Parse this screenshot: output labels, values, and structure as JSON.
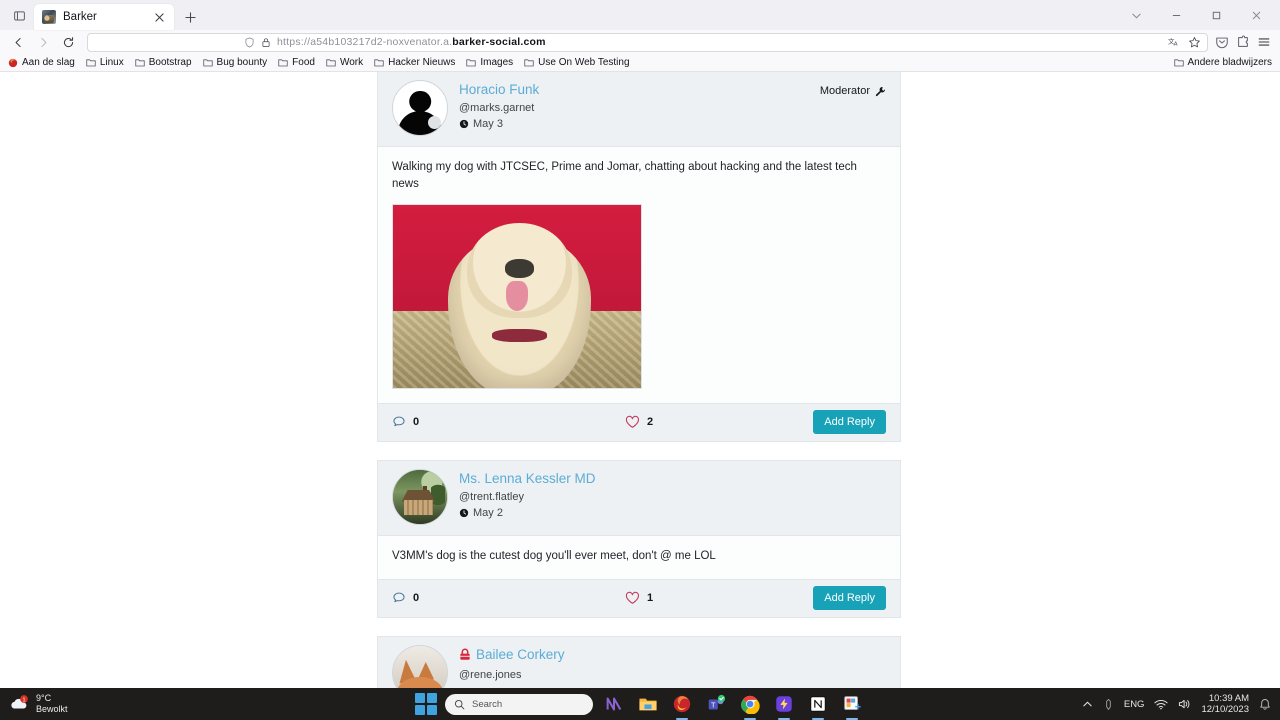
{
  "browser": {
    "tab": {
      "title": "Barker",
      "favicon_icon": "barker-favicon",
      "close_icon": "close-icon"
    },
    "newtab_icon": "plus-icon",
    "tab_list_icon": "tab-list-icon",
    "window_controls": {
      "list_all_tabs_icon": "chevron-down-icon",
      "minimize_icon": "minimize-icon",
      "maximize_icon": "maximize-icon",
      "close_icon": "close-icon"
    },
    "nav": {
      "back_icon": "back-arrow-icon",
      "forward_icon": "forward-arrow-icon",
      "reload_icon": "reload-icon"
    },
    "urlbar": {
      "shield_icon": "shield-icon",
      "lock_icon": "padlock-icon",
      "url_prefix": "https://a54b103217d2-noxvenator.a.",
      "url_domain": "barker-social.com",
      "translate_icon": "translate-icon",
      "bookmark_star_icon": "star-icon"
    },
    "toolbar_right": {
      "pocket_icon": "pocket-save-icon",
      "extensions_icon": "extensions-icon",
      "menu_icon": "hamburger-menu-icon"
    },
    "bookmarks": [
      {
        "label": "Aan de slag",
        "icon": "firefox-icon"
      },
      {
        "label": "Linux",
        "icon": "folder-icon"
      },
      {
        "label": "Bootstrap",
        "icon": "folder-icon"
      },
      {
        "label": "Bug bounty",
        "icon": "folder-icon"
      },
      {
        "label": "Food",
        "icon": "folder-icon"
      },
      {
        "label": "Work",
        "icon": "folder-icon"
      },
      {
        "label": "Hacker Nieuws",
        "icon": "folder-icon"
      },
      {
        "label": "Images",
        "icon": "folder-icon"
      },
      {
        "label": "Use On Web Testing",
        "icon": "folder-icon"
      }
    ],
    "other_bookmarks": {
      "label": "Andere bladwijzers",
      "icon": "folder-icon"
    }
  },
  "theme": {
    "accent": "#17a2b8",
    "link": "#5bacd6",
    "card_header_bg": "#eef1f3",
    "card_body_bg": "#fcfdfd",
    "lock_red": "#d6253c"
  },
  "posts": [
    {
      "display_name": "Horacio Funk",
      "handle": "@marks.garnet",
      "date": "May 3",
      "clock_icon": "clock-icon",
      "avatar_icon": "avatar-silhouette",
      "badge": {
        "label": "Moderator",
        "icon": "wrench-icon"
      },
      "locked": false,
      "text": "Walking my dog with JTCSEC, Prime and Jomar, chatting about hacking and the latest tech news",
      "has_image": true,
      "image_alt": "goldendoodle dog on a couch against a red wall",
      "replies": "0",
      "replies_icon": "comment-icon",
      "likes": "2",
      "likes_icon": "heart-icon",
      "reply_button": "Add Reply"
    },
    {
      "display_name": "Ms. Lenna Kessler MD",
      "handle": "@trent.flatley",
      "date": "May 2",
      "clock_icon": "clock-icon",
      "avatar_icon": "avatar-house",
      "badge": null,
      "locked": false,
      "text": "V3MM's dog is the cutest dog you'll ever meet, don't @ me LOL",
      "has_image": false,
      "replies": "0",
      "replies_icon": "comment-icon",
      "likes": "1",
      "likes_icon": "heart-icon",
      "reply_button": "Add Reply"
    },
    {
      "display_name": "Bailee Corkery",
      "handle": "@rene.jones",
      "date": "",
      "clock_icon": "clock-icon",
      "avatar_icon": "avatar-fox",
      "badge": null,
      "locked": true,
      "lock_icon": "padlock-icon",
      "text": "",
      "has_image": false,
      "replies": "",
      "likes": "",
      "reply_button": ""
    }
  ],
  "taskbar": {
    "weather": {
      "temp": "9°C",
      "condition": "Bewolkt",
      "icon": "cloud-icon",
      "badge": "1"
    },
    "start_icon": "windows-start-icon",
    "search": {
      "placeholder": "Search",
      "icon": "search-icon"
    },
    "apps": [
      {
        "name": "copilot-icon"
      },
      {
        "name": "file-explorer-icon"
      },
      {
        "name": "firefox-icon"
      },
      {
        "name": "microsoft-teams-icon"
      },
      {
        "name": "google-chrome-icon"
      },
      {
        "name": "zap-app-icon"
      },
      {
        "name": "notion-icon"
      },
      {
        "name": "screenshot-tool-icon"
      }
    ],
    "tray": {
      "overflow_icon": "chevron-up-icon",
      "pen_icon": "pen-icon",
      "language": "ENG",
      "wifi_icon": "wifi-icon",
      "volume_icon": "volume-icon",
      "time": "10:39 AM",
      "date": "12/10/2023",
      "notification_icon": "bell-icon"
    }
  }
}
